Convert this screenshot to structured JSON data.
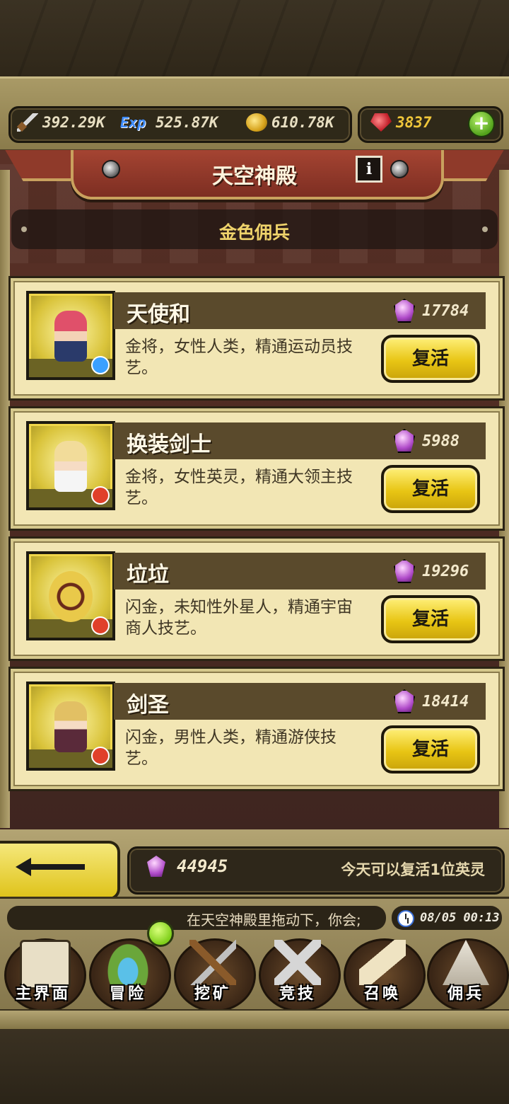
{
  "resources": {
    "attack": "392.29K",
    "exp_icon": "Exp",
    "exp": "525.87K",
    "gold": "610.78K",
    "rubies": "3837"
  },
  "header": {
    "title": "天空神殿",
    "info_label": "i",
    "subtitle": "金色佣兵"
  },
  "heroes": [
    {
      "name": "天使和",
      "cost": "17784",
      "description": "金将，女性人类，精通运动员技艺。",
      "button": "复活",
      "badge_color": "#3aa0ff"
    },
    {
      "name": "换装剑士",
      "cost": "5988",
      "description": "金将，女性英灵，精通大领主技艺。",
      "button": "复活",
      "badge_color": "#e0402a"
    },
    {
      "name": "垃垃",
      "cost": "19296",
      "description": "闪金，未知性外星人，精通宇宙商人技艺。",
      "button": "复活",
      "badge_color": "#e0402a"
    },
    {
      "name": "剑圣",
      "cost": "18414",
      "description": "闪金，男性人类，精通游侠技艺。",
      "button": "复活",
      "badge_color": "#e0402a"
    }
  ],
  "footer": {
    "total_gems": "44945",
    "daily_text": "今天可以复活1位英灵"
  },
  "ticker": {
    "message": "在天空神殿里拖动下，你会;",
    "time": "08/05 00:13"
  },
  "nav": [
    {
      "label": "主界面",
      "icon": "map-scroll-icon"
    },
    {
      "label": "冒险",
      "icon": "island-icon"
    },
    {
      "label": "挖矿",
      "icon": "pickaxe-icon"
    },
    {
      "label": "竞技",
      "icon": "crossed-swords-icon"
    },
    {
      "label": "召唤",
      "icon": "summon-scroll-icon"
    },
    {
      "label": "佣兵",
      "icon": "tent-icon"
    }
  ]
}
